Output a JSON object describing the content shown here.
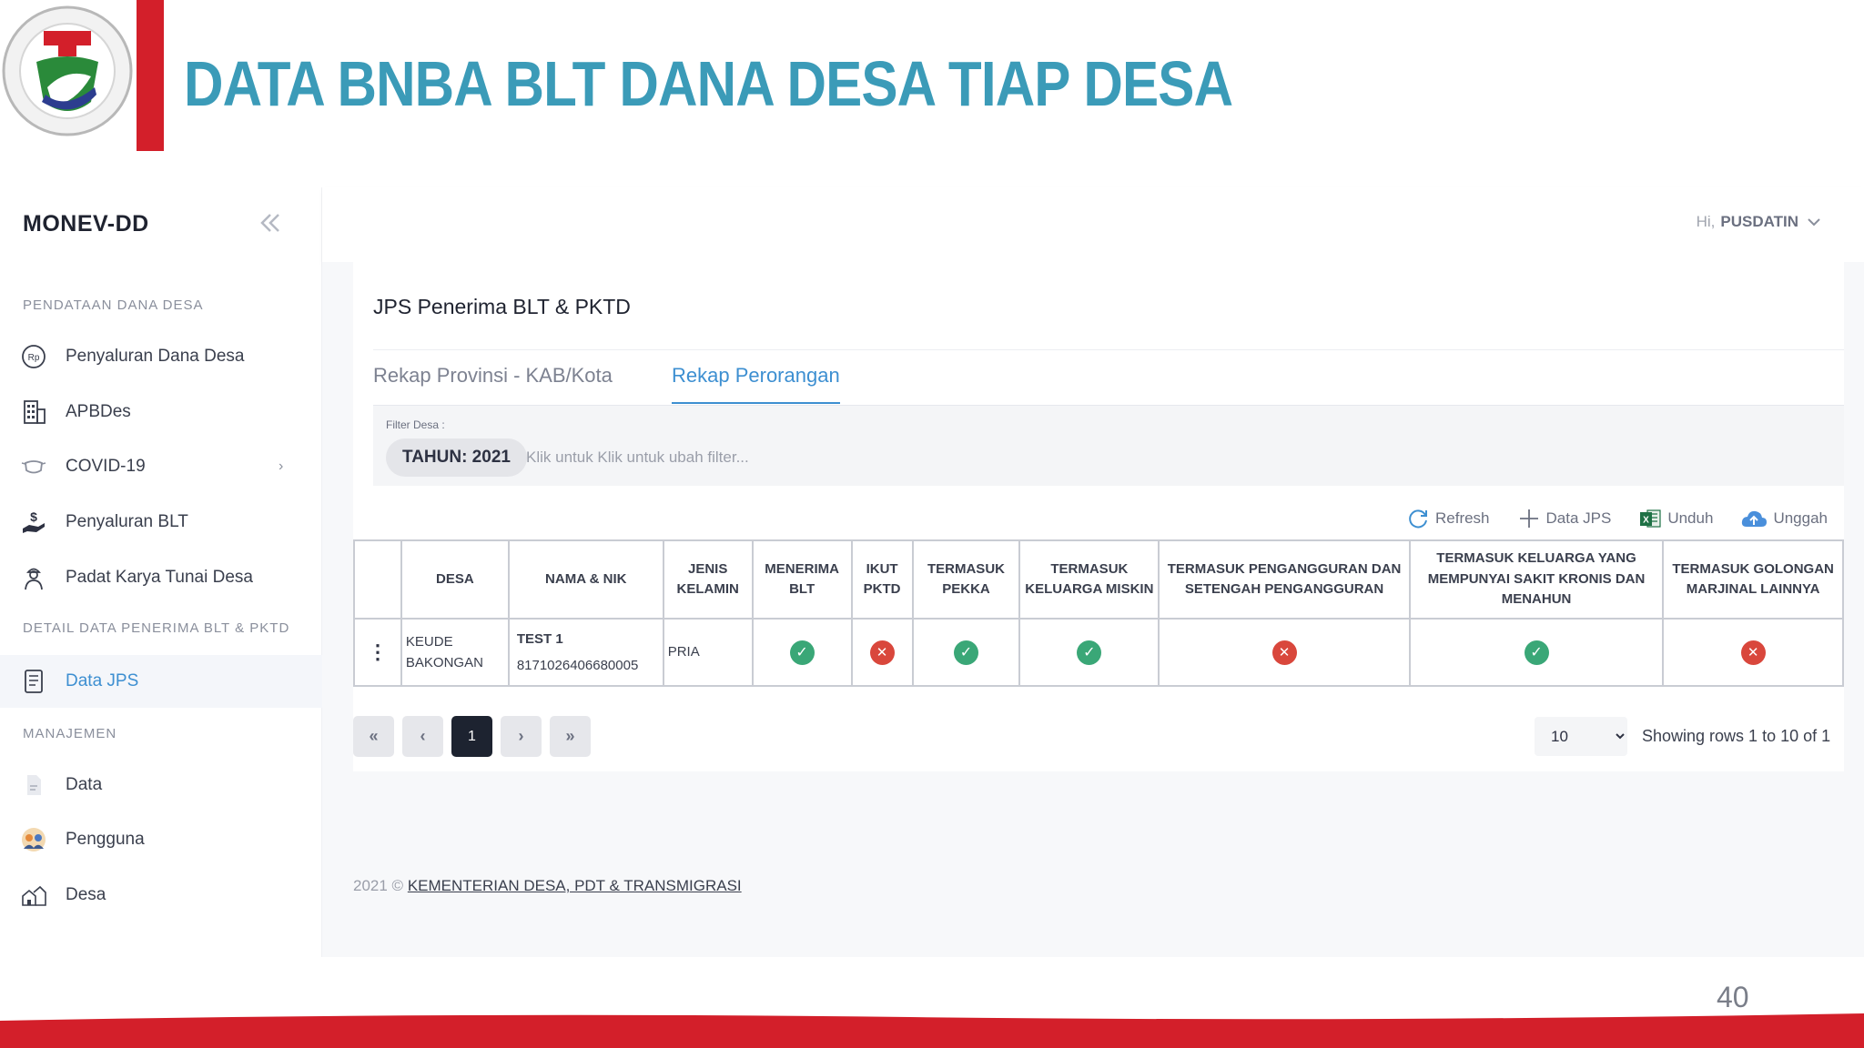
{
  "slide": {
    "title": "DATA BNBA BLT DANA DESA TIAP DESA",
    "page_number": "40",
    "brand_red": "#d31f2a",
    "title_color": "#3b9bb8",
    "logo_icon": "ministry-emblem-icon"
  },
  "app": {
    "brand": "MONEV-DD",
    "greeting_prefix": "Hi,",
    "user": "PUSDATIN",
    "accent": "#3d8fd1"
  },
  "sidebar": {
    "sections": [
      {
        "label": "PENDATAAN DANA DESA"
      },
      {
        "label": "DETAIL DATA PENERIMA BLT & PKTD"
      },
      {
        "label": "MANAJEMEN"
      }
    ],
    "items": [
      {
        "label": "Penyaluran Dana Desa",
        "icon": "rupiah-coin-icon"
      },
      {
        "label": "APBDes",
        "icon": "building-icon"
      },
      {
        "label": "COVID-19",
        "icon": "mask-icon"
      },
      {
        "label": "Penyaluran BLT",
        "icon": "hand-money-icon"
      },
      {
        "label": "Padat Karya Tunai Desa",
        "icon": "worker-icon"
      },
      {
        "label": "Data JPS",
        "icon": "document-list-icon"
      },
      {
        "label": "Data",
        "icon": "file-icon"
      },
      {
        "label": "Pengguna",
        "icon": "users-icon"
      },
      {
        "label": "Desa",
        "icon": "village-icon"
      }
    ]
  },
  "card": {
    "title": "JPS Penerima BLT & PKTD",
    "tabs": [
      {
        "label": "Rekap Provinsi - KAB/Kota"
      },
      {
        "label": "Rekap Perorangan"
      }
    ],
    "filter": {
      "label": "Filter Desa :",
      "chip": "TAHUN: 2021",
      "placeholder": "Klik untuk Klik untuk ubah filter..."
    },
    "toolbar": {
      "refresh": "Refresh",
      "add": "Data JPS",
      "download": "Unduh",
      "upload": "Unggah"
    }
  },
  "table": {
    "headers": [
      "",
      "DESA",
      "NAMA & NIK",
      "JENIS KELAMIN",
      "MENERIMA BLT",
      "IKUT PKTD",
      "TERMASUK PEKKA",
      "TERMASUK KELUARGA MISKIN",
      "TERMASUK PENGANGGURAN DAN SETENGAH PENGANGGURAN",
      "TERMASUK KELUARGA YANG MEMPUNYAI SAKIT KRONIS DAN MENAHUN",
      "TERMASUK GOLONGAN MARJINAL LAINNYA"
    ],
    "rows": [
      {
        "desa_line1": "KEUDE",
        "desa_line2": "BAKONGAN",
        "nama": "TEST 1",
        "nik": "8171026406680005",
        "jenis_kelamin": "PRIA",
        "flags": [
          true,
          false,
          true,
          true,
          false,
          true,
          false
        ]
      }
    ]
  },
  "pagination": {
    "first": "«",
    "prev": "‹",
    "current": "1",
    "next": "›",
    "last": "»",
    "page_size": "10",
    "rows_info": "Showing rows 1 to 10 of 1"
  },
  "footer": {
    "year": "2021 ©",
    "link": "KEMENTERIAN DESA, PDT & TRANSMIGRASI"
  }
}
